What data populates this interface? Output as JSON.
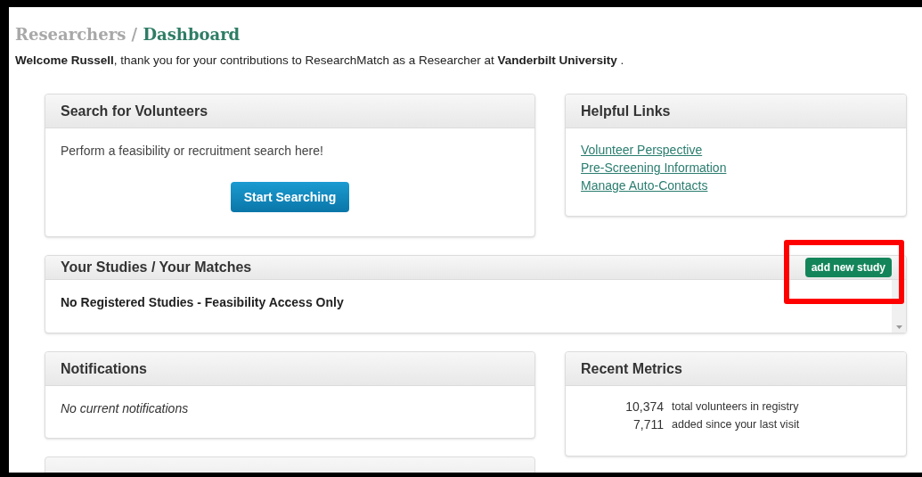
{
  "breadcrumb": {
    "parent": "Researchers /",
    "current": "Dashboard"
  },
  "welcome": "**Welcome Russell**, thank you for your contributions to ResearchMatch as a Researcher at **Vanderbilt University** .",
  "search_panel": {
    "title": "Search for Volunteers",
    "text": "Perform a feasibility or recruitment search here!",
    "button": "Start Searching"
  },
  "links_panel": {
    "title": "Helpful Links",
    "links": [
      "Volunteer Perspective",
      "Pre-Screening Information",
      "Manage Auto-Contacts"
    ]
  },
  "studies_panel": {
    "title": "Your Studies / Your Matches",
    "button": "add new study",
    "highlighted": true,
    "message": "No Registered Studies - Feasibility Access Only"
  },
  "notifications_panel": {
    "title": "Notifications",
    "message": "No current notifications"
  },
  "metrics_panel": {
    "title": "Recent Metrics",
    "metrics": [
      {
        "count": "10,374",
        "description": "total volunteers in registry"
      },
      {
        "count": "7,711",
        "description": "added since your last visit"
      }
    ]
  }
}
